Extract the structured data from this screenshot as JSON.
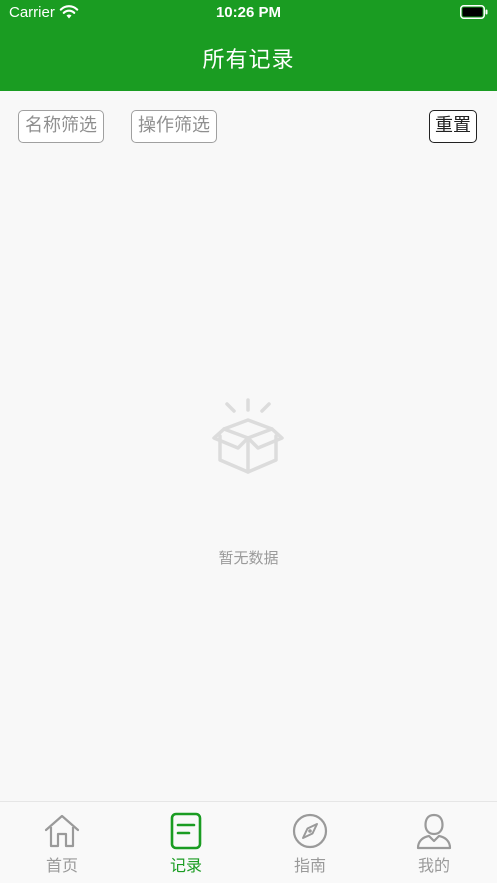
{
  "status_bar": {
    "carrier": "Carrier",
    "time": "10:26 PM"
  },
  "header": {
    "title": "所有记录"
  },
  "filters": {
    "name_filter_label": "名称筛选",
    "operation_filter_label": "操作筛选",
    "reset_label": "重置"
  },
  "empty_state": {
    "text": "暂无数据",
    "icon": "empty-box-icon"
  },
  "tabbar": {
    "items": [
      {
        "label": "首页",
        "icon": "home-icon",
        "active": false
      },
      {
        "label": "记录",
        "icon": "record-icon",
        "active": true
      },
      {
        "label": "指南",
        "icon": "compass-icon",
        "active": false
      },
      {
        "label": "我的",
        "icon": "user-icon",
        "active": false
      }
    ]
  },
  "colors": {
    "primary": "#1a9c22",
    "inactive": "#9a9a9a",
    "background": "#f8f8f8"
  }
}
